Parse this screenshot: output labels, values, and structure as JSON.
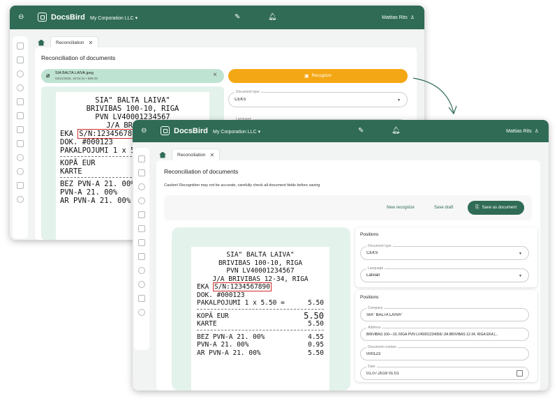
{
  "app": {
    "brand": "DocsBird",
    "company": "My Corporation LLC ▾",
    "user": "Mattias Rits"
  },
  "tab": {
    "label": "Reconciliation"
  },
  "page_title": "Reconciliation of documents",
  "back_window": {
    "file": {
      "name": "SIA BALTA LAIVA.jpeg",
      "meta": "03/21/2025, 16:04:34 • 589 Kb"
    },
    "recognize_label": "Recognize",
    "doc_type": {
      "label": "Document type",
      "value": "CEKS"
    },
    "language": {
      "label": "Language"
    }
  },
  "front_window": {
    "warning": "Caution! Recognition may not be accurate, carefully check all document fields before saving",
    "actions": {
      "new_recognize": "New recognize",
      "save_draft": "Save draft",
      "save_as_document": "Save as document"
    },
    "positions_title_1": "Positions",
    "positions_title_2": "Positions",
    "doc_type": {
      "label": "Document type",
      "value": "CEKS"
    },
    "language": {
      "label": "Language",
      "value": "Latvian"
    },
    "company": {
      "label": "Company",
      "value": "SIA\" BALTA LAIVA\""
    },
    "address": {
      "label": "Address",
      "value": "BRĪVĪBAS 100—10, RĪGA PVN LV40001234956/ J/A BRĪVĪBAS 12-34, RĪGA EKA [..."
    },
    "document_number": {
      "label": "Document number",
      "value": "000123"
    },
    "date": {
      "label": "Date",
      "value": "01.07.2019 01:01"
    }
  },
  "receipt": {
    "line1": "SIA\" BALTA LAIVA\"",
    "line2": "BRIVIBAS 100-10, RIGA",
    "line3": "PVN LV40001234567",
    "line4": "J/A BRIVIBAS 12-34, RIGA",
    "eka": "EKA ",
    "sn": "S/N:1234567890",
    "dok": "DOK. #000123",
    "pak": "PAKALPOJUMI 1 x 5.50 =",
    "pak_val": "5.50",
    "kopa": "KOPĀ EUR",
    "kopa_val": "5.50",
    "karte": "KARTE",
    "karte_val": "5.50",
    "bez": "BEZ PVN-A 21. 00%",
    "bez_val": "4.55",
    "pvn": "PVN-A 21. 00%",
    "pvn_val": "0.95",
    "ar": "AR PVN-A 21. 00%",
    "ar_val": "5.50",
    "back_line2": "BRIVIBAS 100-10, RIGA",
    "back_line4": "J/A BRIVIBAS",
    "back_eka": "EKA",
    "back_sn": "S/N:123456789",
    "back_pak": "PAKALPOJUMI 1 x 5",
    "back_bez": "BEZ PVN-A 21. 00%",
    "back_pvn": "PVN-A 21. 00%",
    "back_ar": "AR PVN-A 21. 00%",
    "back_ce": "ČE"
  },
  "colors": {
    "primary": "#2f6b55",
    "recognize": "#f4a714",
    "file_chip": "#bfe3d3",
    "receipt_bg": "#e4f2ec",
    "sn_box": "#d42a2a"
  }
}
